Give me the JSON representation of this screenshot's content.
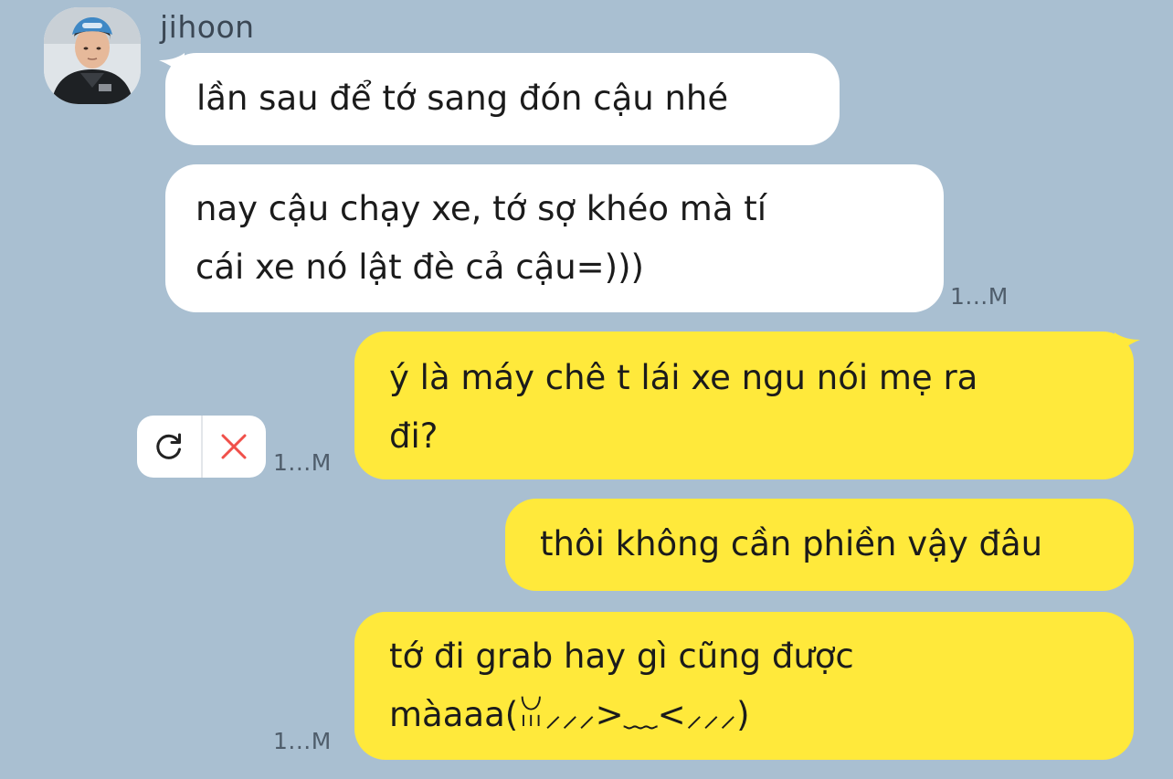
{
  "contact": {
    "name": "jihoon"
  },
  "messages": [
    {
      "id": "msg1",
      "direction": "incoming",
      "text": "lần sau để tớ sang đón cậu nhé"
    },
    {
      "id": "msg2",
      "direction": "incoming",
      "lines": [
        "nay cậu chạy xe, tớ sợ khéo mà tí",
        "cái xe nó lật đè cả cậu=)))"
      ],
      "time": "1...M"
    },
    {
      "id": "msg3",
      "direction": "outgoing",
      "lines": [
        "ý là máy chê t lái xe ngu nói mẹ ra",
        "đi?"
      ],
      "time": "1...M",
      "status": "failed"
    },
    {
      "id": "msg4",
      "direction": "outgoing",
      "text": "thôi không cần phiền vậy đâu"
    },
    {
      "id": "msg5",
      "direction": "outgoing",
      "lines": [
        "tớ đi grab hay gì cũng được",
        "màaaa(ꈍ⸝⸝⸝>﹏<⸝⸝⸝)"
      ],
      "time": "1...M"
    }
  ],
  "failed_actions": {
    "retry_icon": "retry-icon",
    "delete_icon": "close-icon"
  },
  "colors": {
    "background": "#a9bfd1",
    "incoming_bubble": "#ffffff",
    "outgoing_bubble": "#ffe93b",
    "delete_red": "#f0504a"
  }
}
